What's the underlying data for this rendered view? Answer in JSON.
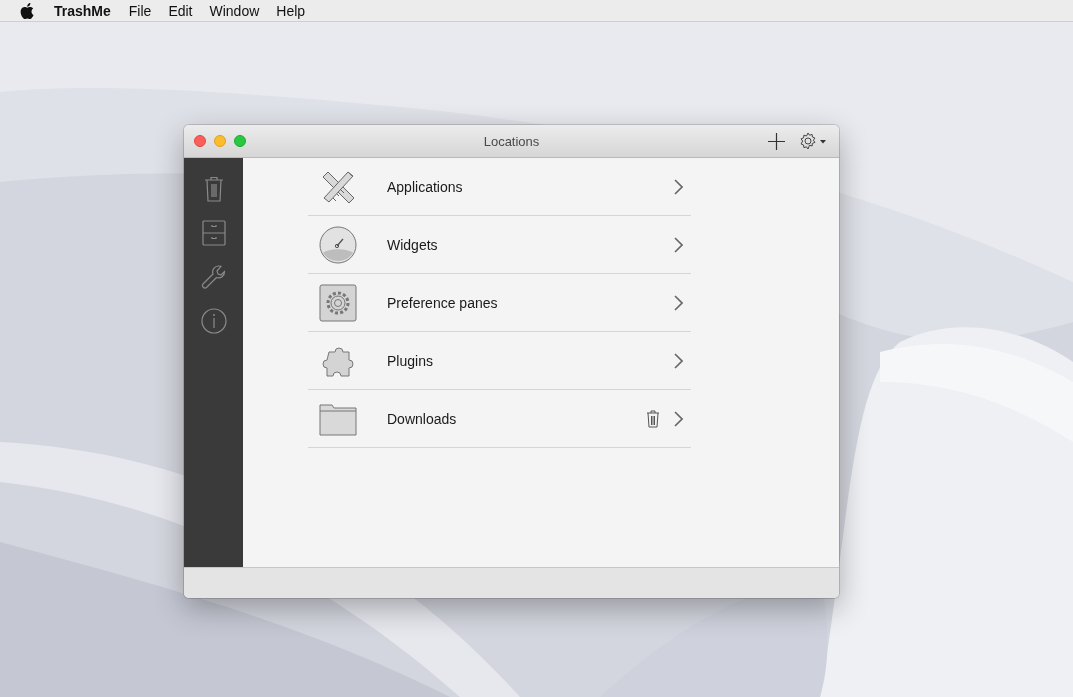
{
  "menu_bar": {
    "app_name": "TrashMe",
    "items": [
      "File",
      "Edit",
      "Window",
      "Help"
    ]
  },
  "window": {
    "title": "Locations"
  },
  "locations": [
    {
      "kind": "applications",
      "label": "Applications",
      "removable": false
    },
    {
      "kind": "widgets",
      "label": "Widgets",
      "removable": false
    },
    {
      "kind": "preference-panes",
      "label": "Preference panes",
      "removable": false
    },
    {
      "kind": "plugins",
      "label": "Plugins",
      "removable": false
    },
    {
      "kind": "folder",
      "label": "Downloads",
      "removable": true
    }
  ]
}
